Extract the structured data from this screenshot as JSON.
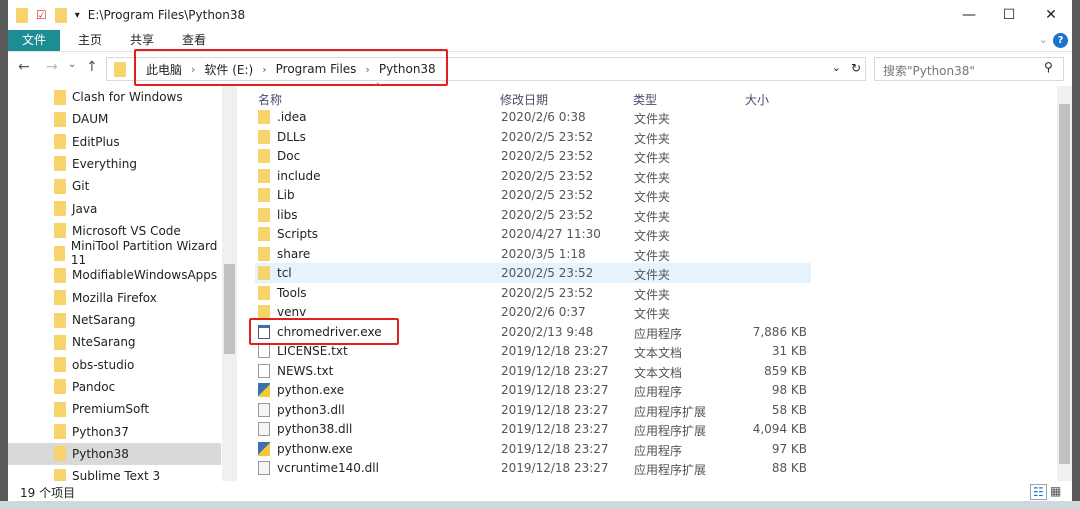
{
  "title": "E:\\Program Files\\Python38",
  "window_controls": {
    "minimize": "—",
    "maximize": "☐",
    "close": "✕"
  },
  "ribbon": {
    "tabs": [
      "文件",
      "主页",
      "共享",
      "查看"
    ],
    "help": "?"
  },
  "nav": {
    "back": "←",
    "forward": "→",
    "recent": "⌄",
    "up": "↑",
    "breadcrumbs": [
      "此电脑",
      "软件 (E:)",
      "Program Files",
      "Python38"
    ],
    "refresh": "↻",
    "search_placeholder": "搜索\"Python38\"",
    "search_icon": "⚲"
  },
  "tree": [
    "Clash for Windows",
    "DAUM",
    "EditPlus",
    "Everything",
    "Git",
    "Java",
    "Microsoft VS Code",
    "MiniTool Partition Wizard 11",
    "ModifiableWindowsApps",
    "Mozilla Firefox",
    "NetSarang",
    "NteSarang",
    "obs-studio",
    "Pandoc",
    "PremiumSoft",
    "Python37",
    "Python38",
    "Sublime Text 3"
  ],
  "tree_selected": "Python38",
  "columns": [
    "名称",
    "修改日期",
    "类型",
    "大小"
  ],
  "files": [
    {
      "name": ".idea",
      "date": "2020/2/6 0:38",
      "type": "文件夹",
      "size": "",
      "icon": "folder"
    },
    {
      "name": "DLLs",
      "date": "2020/2/5 23:52",
      "type": "文件夹",
      "size": "",
      "icon": "folder"
    },
    {
      "name": "Doc",
      "date": "2020/2/5 23:52",
      "type": "文件夹",
      "size": "",
      "icon": "folder"
    },
    {
      "name": "include",
      "date": "2020/2/5 23:52",
      "type": "文件夹",
      "size": "",
      "icon": "folder"
    },
    {
      "name": "Lib",
      "date": "2020/2/5 23:52",
      "type": "文件夹",
      "size": "",
      "icon": "folder"
    },
    {
      "name": "libs",
      "date": "2020/2/5 23:52",
      "type": "文件夹",
      "size": "",
      "icon": "folder"
    },
    {
      "name": "Scripts",
      "date": "2020/4/27 11:30",
      "type": "文件夹",
      "size": "",
      "icon": "folder"
    },
    {
      "name": "share",
      "date": "2020/3/5 1:18",
      "type": "文件夹",
      "size": "",
      "icon": "folder"
    },
    {
      "name": "tcl",
      "date": "2020/2/5 23:52",
      "type": "文件夹",
      "size": "",
      "icon": "folder"
    },
    {
      "name": "Tools",
      "date": "2020/2/5 23:52",
      "type": "文件夹",
      "size": "",
      "icon": "folder"
    },
    {
      "name": "venv",
      "date": "2020/2/6 0:37",
      "type": "文件夹",
      "size": "",
      "icon": "folder"
    },
    {
      "name": "chromedriver.exe",
      "date": "2020/2/13 9:48",
      "type": "应用程序",
      "size": "7,886 KB",
      "icon": "exe"
    },
    {
      "name": "LICENSE.txt",
      "date": "2019/12/18 23:27",
      "type": "文本文档",
      "size": "31 KB",
      "icon": "txt"
    },
    {
      "name": "NEWS.txt",
      "date": "2019/12/18 23:27",
      "type": "文本文档",
      "size": "859 KB",
      "icon": "txt"
    },
    {
      "name": "python.exe",
      "date": "2019/12/18 23:27",
      "type": "应用程序",
      "size": "98 KB",
      "icon": "py"
    },
    {
      "name": "python3.dll",
      "date": "2019/12/18 23:27",
      "type": "应用程序扩展",
      "size": "58 KB",
      "icon": "dll"
    },
    {
      "name": "python38.dll",
      "date": "2019/12/18 23:27",
      "type": "应用程序扩展",
      "size": "4,094 KB",
      "icon": "dll"
    },
    {
      "name": "pythonw.exe",
      "date": "2019/12/18 23:27",
      "type": "应用程序",
      "size": "97 KB",
      "icon": "py"
    },
    {
      "name": "vcruntime140.dll",
      "date": "2019/12/18 23:27",
      "type": "应用程序扩展",
      "size": "88 KB",
      "icon": "dll"
    }
  ],
  "hover_row": "tcl",
  "status": "19 个项目",
  "colors": {
    "accent": "#1e8c93",
    "highlight": "#e02020",
    "folder": "#f6d36b"
  }
}
